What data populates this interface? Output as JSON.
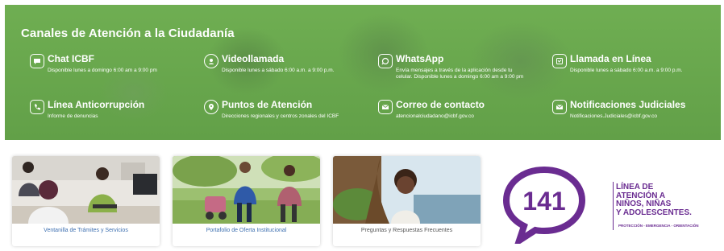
{
  "banner": {
    "title": "Canales de Atención a la Ciudadanía",
    "channels": [
      {
        "icon": "chat-icon",
        "name": "Chat ICBF",
        "desc": "Disponible lunes a domingo 6:00 am a 9:00 pm"
      },
      {
        "icon": "video-icon",
        "name": "Videollamada",
        "desc": "Disponible lunes a sábado 6:00 a.m. a 9:00 p.m."
      },
      {
        "icon": "whatsapp-icon",
        "name": "WhatsApp",
        "desc": "Envía mensajes a través de la aplicación desde tu celular. Disponible lunes a domingo 6:00 am a 9:00 pm"
      },
      {
        "icon": "phone-screen-icon",
        "name": "Llamada en Línea",
        "desc": "Disponible lunes a sábado 6:00 a.m. a 9:00 p.m."
      },
      {
        "icon": "phone-icon",
        "name": "Línea Anticorrupción",
        "desc": "Informe de denuncias"
      },
      {
        "icon": "location-pin-icon",
        "name": "Puntos de Atención",
        "desc": "Direcciones regionales y centros zonales del ICBF"
      },
      {
        "icon": "mail-icon",
        "name": "Correo de contacto",
        "desc": "atencionalciudadano@icbf.gov.co"
      },
      {
        "icon": "mail-icon",
        "name": "Notificaciones Judiciales",
        "desc": "Notificaciones.Judiciales@icbf.gov.co"
      }
    ]
  },
  "cards": [
    {
      "label": "Ventanilla de Trámites y Servicios"
    },
    {
      "label": "Portafolio de Oferta Institucional"
    },
    {
      "label": "Preguntas y Respuestas Frecuentes"
    }
  ],
  "logo": {
    "number": "141",
    "line1": "LÍNEA DE",
    "line2": "ATENCIÓN A",
    "line3": "NIÑOS, NIÑAS",
    "line4": "Y ADOLESCENTES.",
    "sub": "PROTECCIÓN - EMERGENCIA - ORIENTACIÓN",
    "color": "#6a2c91"
  },
  "colors": {
    "banner": "#6aa84f",
    "link": "#3d6fb0"
  }
}
